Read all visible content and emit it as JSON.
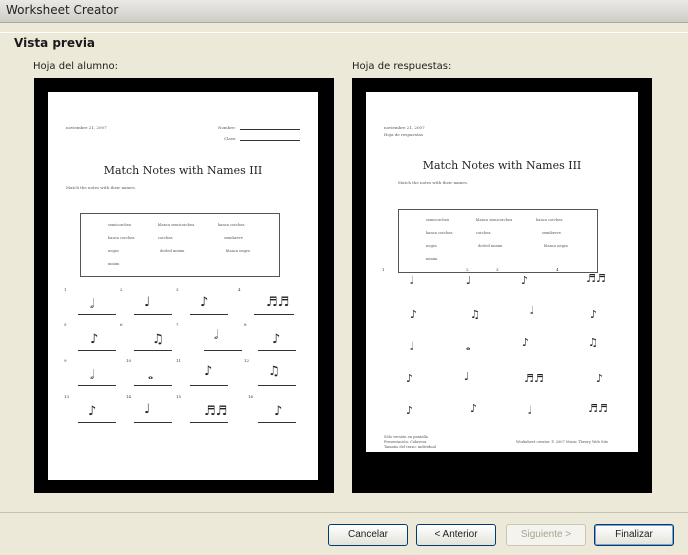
{
  "window": {
    "title": "Worksheet Creator"
  },
  "section": {
    "title": "Vista previa"
  },
  "student": {
    "label": "Hoja del alumno:",
    "date": "noviembre 21, 2007",
    "name_label": "Nombre:",
    "class_label": "Clase:",
    "title": "Match Notes with Names III",
    "instructions": "Match the notes with their names.",
    "word_bank": [
      "semicorchea",
      "blanca semicorchea",
      "banca corchea",
      "banca corchea",
      "corchea",
      "semibreve",
      "negra",
      "dotted minim",
      "blanca negra",
      "minim"
    ]
  },
  "answer": {
    "label": "Hoja de respuestas:",
    "date": "noviembre 21, 2007",
    "subtitle": "Hoja de respuestas",
    "title": "Match Notes with Names III",
    "instructions": "Match the notes with their names.",
    "word_bank": [
      "semicorchea",
      "blanca semicorchea",
      "banca corchea",
      "banca corchea",
      "corchea",
      "semibreve",
      "negra",
      "dotted minim",
      "blanca negra",
      "minim"
    ],
    "footer_left": [
      "Sólo versión en pantalla",
      "Presentación: Calavera",
      "Tamaño del trazo: individual"
    ],
    "footer_right": "Worksheet creator © 2007 Music Theory Web Site"
  },
  "buttons": {
    "cancel": "Cancelar",
    "back": "< Anterior",
    "next": "Siguiente >",
    "finish": "Finalizar"
  }
}
